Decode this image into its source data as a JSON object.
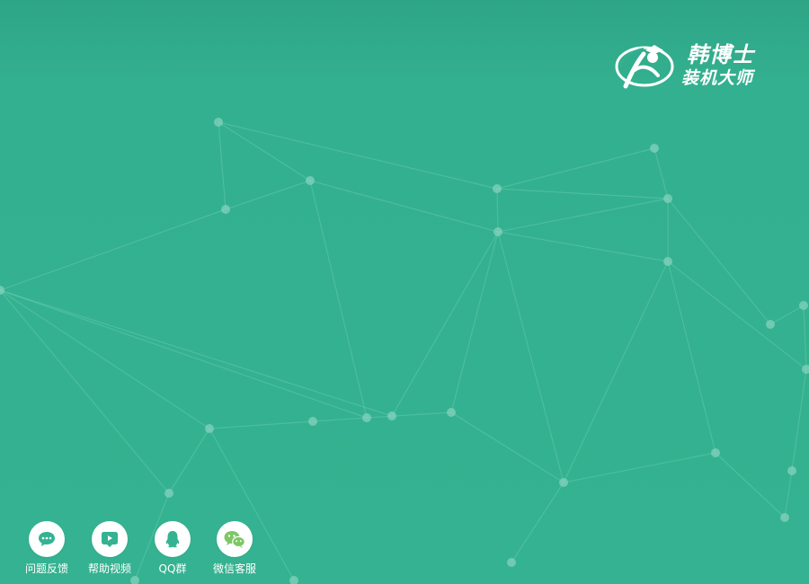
{
  "colors": {
    "background": "#34b291",
    "accent": "#34b291",
    "network_line": "#7bd7b9",
    "network_node": "#84d2bc",
    "wechat_green": "#7dc765"
  },
  "brand": {
    "logo_icon": "graduate-runner-logo",
    "line1": "韩博士",
    "line2": "装机大师"
  },
  "dock": [
    {
      "label": "问题反馈",
      "icon": "chat-bubble-icon"
    },
    {
      "label": "帮助视频",
      "icon": "play-video-icon"
    },
    {
      "label": "QQ群",
      "icon": "qq-penguin-icon"
    },
    {
      "label": "微信客服",
      "icon": "wechat-icon"
    }
  ]
}
